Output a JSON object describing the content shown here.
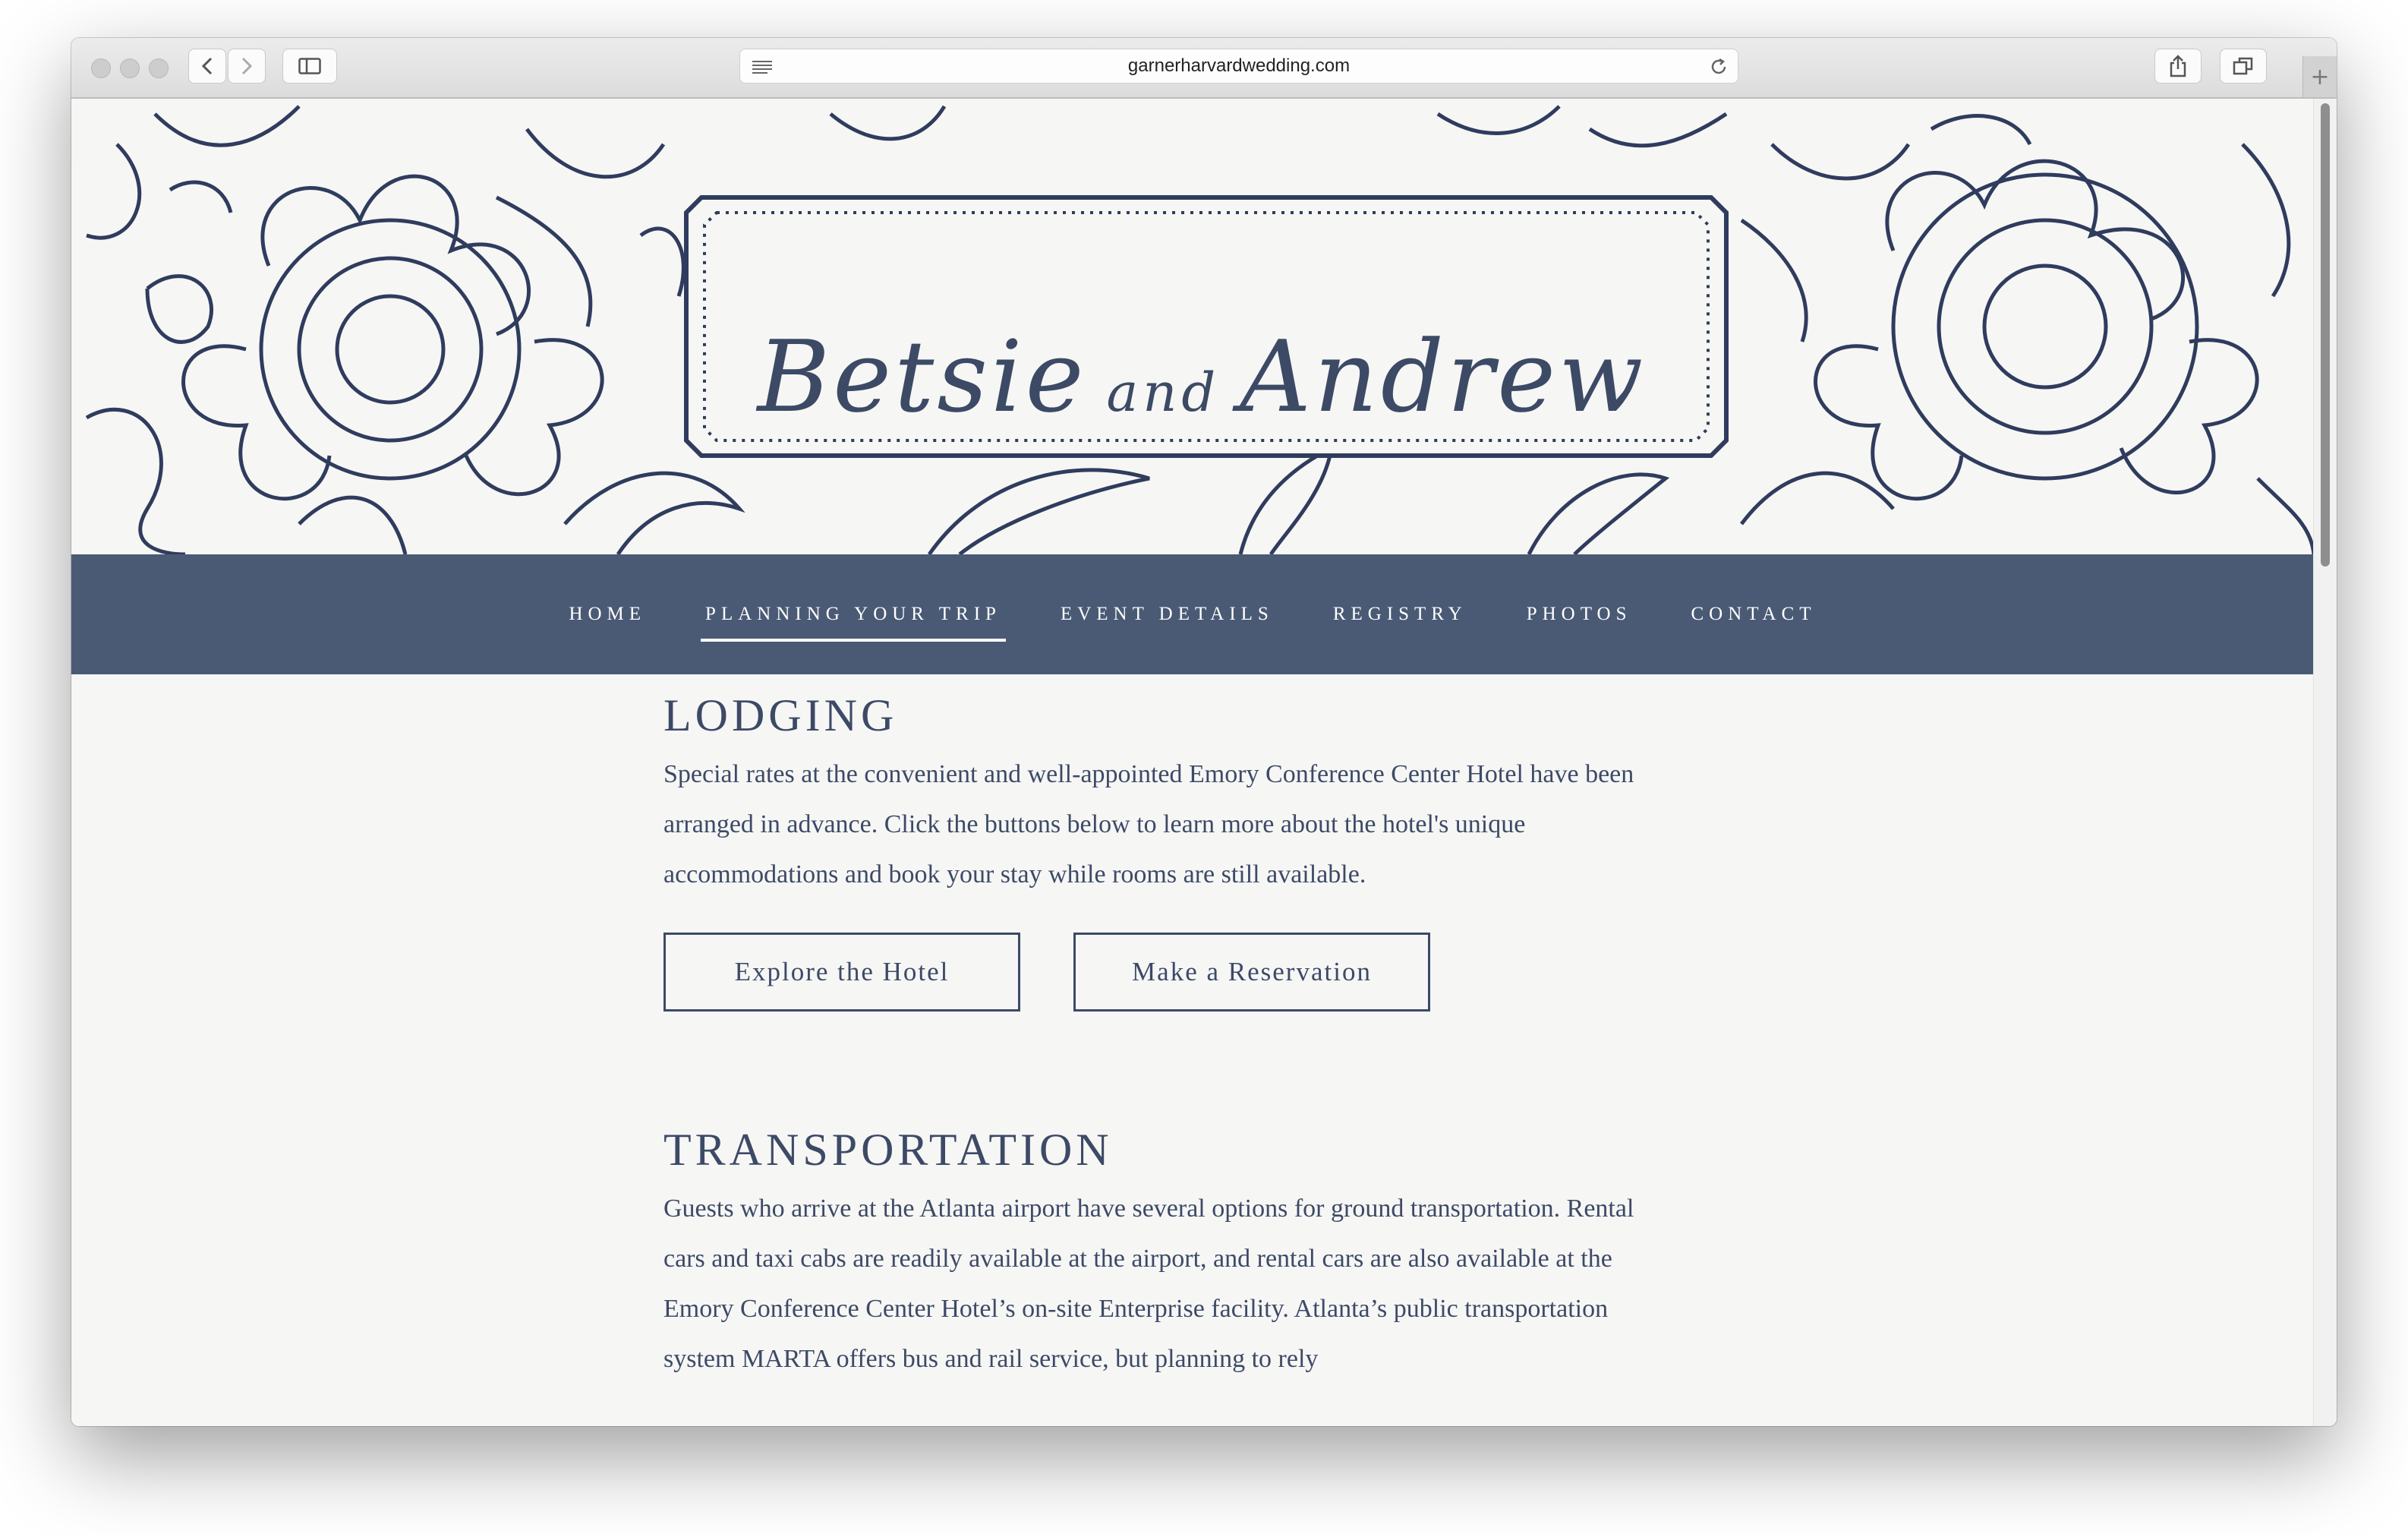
{
  "browser": {
    "url": "garnerharvardwedding.com",
    "icons": [
      "back-icon",
      "forward-icon",
      "sidebar-icon",
      "reader-icon",
      "reload-icon",
      "share-icon",
      "tabs-icon",
      "new-tab-icon"
    ]
  },
  "site": {
    "title_first": "Betsie",
    "title_and": "and",
    "title_second": "Andrew",
    "nav": [
      {
        "label": "HOME",
        "active": false
      },
      {
        "label": "PLANNING YOUR TRIP",
        "active": true
      },
      {
        "label": "EVENT DETAILS",
        "active": false
      },
      {
        "label": "REGISTRY",
        "active": false
      },
      {
        "label": "PHOTOS",
        "active": false
      },
      {
        "label": "CONTACT",
        "active": false
      }
    ]
  },
  "lodging": {
    "heading": "LODGING",
    "text": "Special rates at the convenient and well-appointed Emory Conference Center Hotel have been arranged in advance. Click the buttons below to learn more about the hotel's unique accommodations and book your stay while rooms are still available.",
    "button_explore": "Explore the Hotel",
    "button_reserve": "Make a Reservation"
  },
  "transportation": {
    "heading": "TRANSPORTATION",
    "text": "Guests who arrive at the Atlanta airport have several options for ground transportation. Rental cars and taxi cabs are readily available at the airport, and rental cars are also available at the Emory Conference Center Hotel’s on-site Enterprise facility.  Atlanta’s public transportation system MARTA offers bus and rail service, but planning to rely"
  },
  "colors": {
    "navy": "#3d4a66",
    "nav_bg": "#4a5a75",
    "page_bg": "#f6f6f5"
  }
}
